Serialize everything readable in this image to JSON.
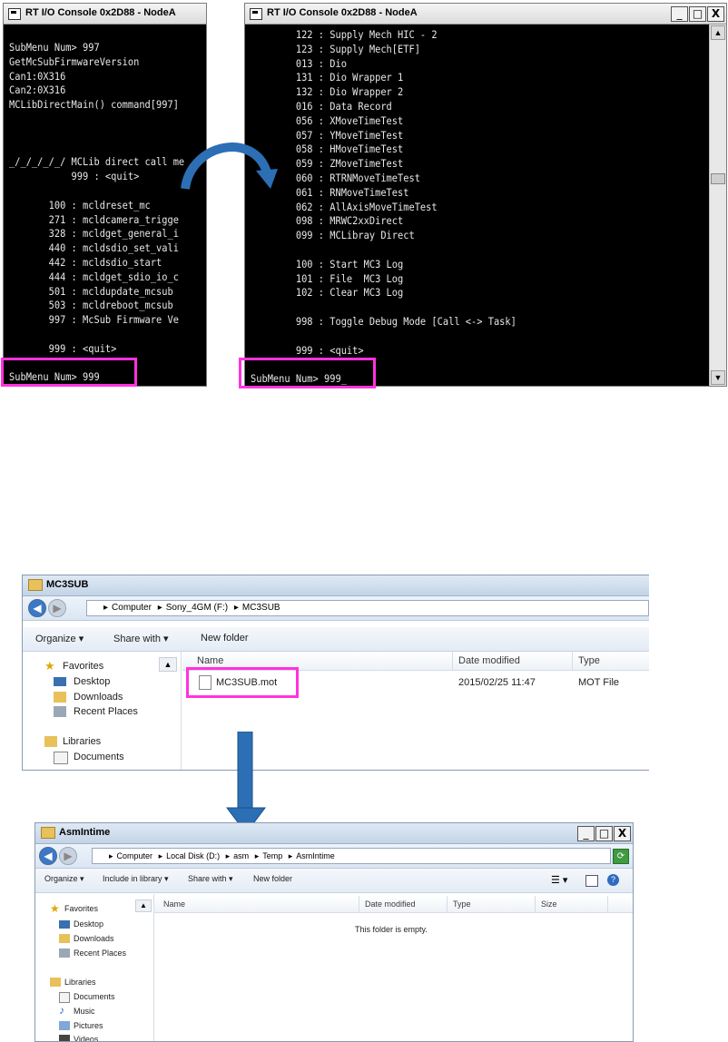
{
  "console_left": {
    "title": "RT I/O Console 0x2D88 - NodeA",
    "lines": [
      "SubMenu Num> 997",
      "GetMcSubFirmwareVersion",
      "Can1:0X316",
      "Can2:0X316",
      "MCLibDirectMain() command[997]",
      "",
      "",
      "",
      "_/_/_/_/_/ MCLib direct call me",
      "           999 : <quit>",
      "",
      "       100 : mcldreset_mc",
      "       271 : mcldcamera_trigge",
      "       328 : mcldget_general_i",
      "       440 : mcldsdio_set_vali",
      "       442 : mcldsdio_start",
      "       444 : mcldget_sdio_io_c",
      "       501 : mcldupdate_mcsub",
      "       503 : mcldreboot_mcsub",
      "       997 : McSub Firmware Ve",
      "",
      "       999 : <quit>",
      "",
      "SubMenu Num> 999"
    ]
  },
  "console_right": {
    "title": "RT I/O Console 0x2D88 - NodeA",
    "lines": [
      "        122 : Supply Mech HIC - 2",
      "        123 : Supply Mech[ETF]",
      "        013 : Dio",
      "        131 : Dio Wrapper 1",
      "        132 : Dio Wrapper 2",
      "        016 : Data Record",
      "        056 : XMoveTimeTest",
      "        057 : YMoveTimeTest",
      "        058 : HMoveTimeTest",
      "        059 : ZMoveTimeTest",
      "        060 : RTRNMoveTimeTest",
      "        061 : RNMoveTimeTest",
      "        062 : AllAxisMoveTimeTest",
      "        098 : MRWC2xxDirect",
      "        099 : MCLibray Direct",
      "",
      "        100 : Start MC3 Log",
      "        101 : File  MC3 Log",
      "        102 : Clear MC3 Log",
      "",
      "        998 : Toggle Debug Mode [Call <-> Task]",
      "",
      "        999 : <quit>",
      "",
      "SubMenu Num> 999"
    ],
    "buttons": {
      "minimize": "_",
      "maximize": "□",
      "close": "X"
    }
  },
  "explorer_top": {
    "title": "MC3SUB",
    "breadcrumb": [
      "Computer",
      "Sony_4GM (F:)",
      "MC3SUB"
    ],
    "toolbar": [
      "Organize ▾",
      "Share with ▾",
      "New folder"
    ],
    "nav": [
      "Favorites",
      "Desktop",
      "Downloads",
      "Recent Places",
      "Libraries",
      "Documents"
    ],
    "columns": [
      "Name",
      "Date modified",
      "Type"
    ],
    "file": {
      "name": "MC3SUB.mot",
      "date": "2015/02/25 11:47",
      "type": "MOT File"
    }
  },
  "explorer_bottom": {
    "title": "AsmIntime",
    "breadcrumb": [
      "Computer",
      "Local Disk (D:)",
      "asm",
      "Temp",
      "AsmIntime"
    ],
    "toolbar": [
      "Organize ▾",
      "Include in library ▾",
      "Share with ▾",
      "New folder"
    ],
    "nav": [
      "Favorites",
      "Desktop",
      "Downloads",
      "Recent Places",
      "Libraries",
      "Documents",
      "Music",
      "Pictures",
      "Videos"
    ],
    "columns": [
      "Name",
      "Date modified",
      "Type",
      "Size"
    ],
    "empty_message": "This folder is empty.",
    "buttons": {
      "minimize": "_",
      "maximize": "□",
      "close": "X"
    }
  },
  "colors": {
    "highlight": "#ff33dd",
    "arrow": "#2c6fb5"
  }
}
